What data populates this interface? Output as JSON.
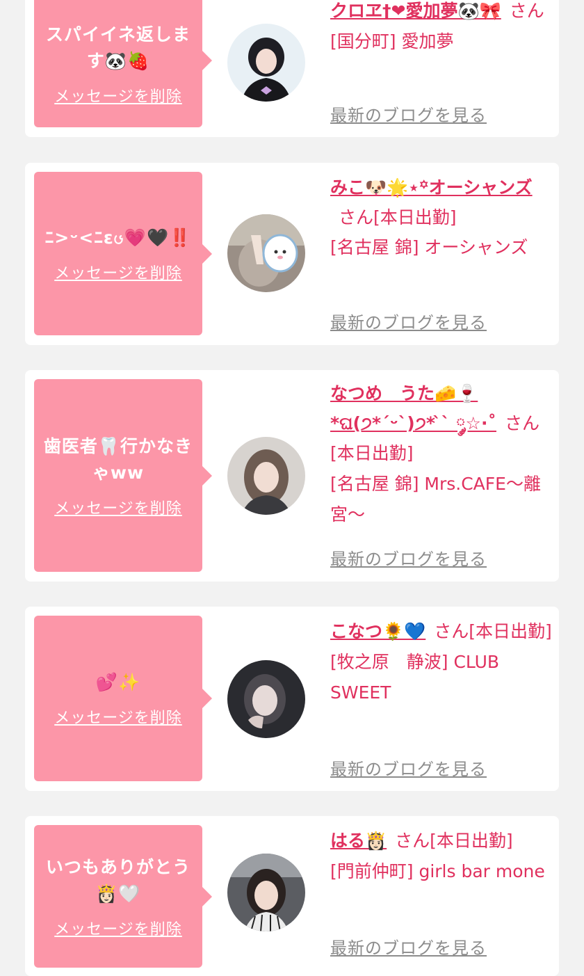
{
  "cards": [
    {
      "message": "スパイイネ返します🐼🍓",
      "delete_label": "メッセージを削除",
      "name": "クロヱ†❤愛加夢🐼🎀",
      "san": "さん",
      "status": "",
      "shop": "[国分町] 愛加夢",
      "blog_label": "最新のブログを見る"
    },
    {
      "message": "ﾆ>ᵕ<ﾆεၒ💗🖤‼️",
      "delete_label": "メッセージを削除",
      "name": "みこ🐶🌟⋆꙳オーシャンズ",
      "san": "さん",
      "status": "[本日出勤]",
      "shop": "[名古屋 錦] オーシャンズ",
      "blog_label": "最新のブログを見る"
    },
    {
      "message": "歯医者🦷行かなきゃww",
      "delete_label": "メッセージを削除",
      "name": "なつめ　うた🧀🍷*ଘ(੭*ˊᵕˋ)੭* ̀ˋ ༘☆·˚",
      "san": "さん",
      "status": "[本日出勤]",
      "shop": "[名古屋 錦] Mrs.CAFE〜離宮〜",
      "blog_label": "最新のブログを見る"
    },
    {
      "message": "💕✨",
      "delete_label": "メッセージを削除",
      "name": "こなつ🌻💙",
      "san": "さん",
      "status": "[本日出勤]",
      "shop": "[牧之原　静波] CLUB SWEET",
      "blog_label": "最新のブログを見る"
    },
    {
      "message": "いつもありがとう👸🏻🤍",
      "delete_label": "メッセージを削除",
      "name": "はる👸🏻",
      "san": "さん",
      "status": "[本日出勤]",
      "shop": "[門前仲町] girls bar mone",
      "blog_label": "最新のブログを見る"
    }
  ]
}
